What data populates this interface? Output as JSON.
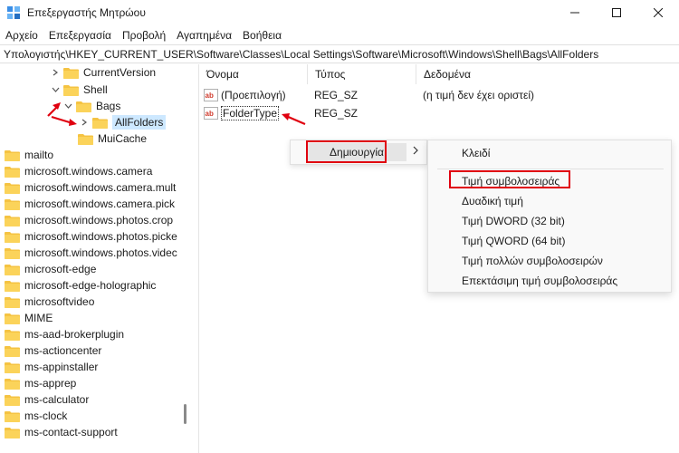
{
  "window": {
    "title": "Επεξεργαστής Μητρώου",
    "controls": [
      "minimize-icon",
      "maximize-icon",
      "close-icon"
    ]
  },
  "menu": [
    "Αρχείο",
    "Επεξεργασία",
    "Προβολή",
    "Αγαπημένα",
    "Βοήθεια"
  ],
  "address": "Υπολογιστής\\HKEY_CURRENT_USER\\Software\\Classes\\Local Settings\\Software\\Microsoft\\Windows\\Shell\\Bags\\AllFolders",
  "tree": {
    "top": [
      {
        "label": "CurrentVersion",
        "expander": "collapsed"
      },
      {
        "label": "Shell",
        "expander": "expanded"
      },
      {
        "label": "Bags",
        "expander": "expanded"
      },
      {
        "label": "AllFolders",
        "expander": "collapsed",
        "selected": true
      },
      {
        "label": "MuiCache",
        "expander": "none"
      }
    ],
    "roots": [
      "mailto",
      "microsoft.windows.camera",
      "microsoft.windows.camera.mult",
      "microsoft.windows.camera.pick",
      "microsoft.windows.photos.crop",
      "microsoft.windows.photos.picke",
      "microsoft.windows.photos.videc",
      "microsoft-edge",
      "microsoft-edge-holographic",
      "microsoftvideo",
      "MIME",
      "ms-aad-brokerplugin",
      "ms-actioncenter",
      "ms-appinstaller",
      "ms-apprep",
      "ms-calculator",
      "ms-clock",
      "ms-contact-support"
    ]
  },
  "columns": {
    "name": "Όνομα",
    "type": "Τύπος",
    "data": "Δεδομένα"
  },
  "rows": [
    {
      "name": "(Προεπιλογή)",
      "type": "REG_SZ",
      "data": "(η τιμή δεν έχει οριστεί)"
    },
    {
      "name": "FolderType",
      "type": "REG_SZ",
      "data": ""
    }
  ],
  "context_menu": {
    "new_label": "Δημιουργία"
  },
  "submenu": {
    "items": [
      "Κλειδί",
      "Τιμή συμβολοσειράς",
      "Δυαδική τιμή",
      "Τιμή DWORD (32 bit)",
      "Τιμή QWORD (64 bit)",
      "Τιμή πολλών συμβολοσειρών",
      "Επεκτάσιμη τιμή συμβολοσειράς"
    ]
  },
  "colors": {
    "highlight_red": "#e0000f",
    "folder_yellow": "#f5c342",
    "selection_blue": "#cde8ff"
  }
}
